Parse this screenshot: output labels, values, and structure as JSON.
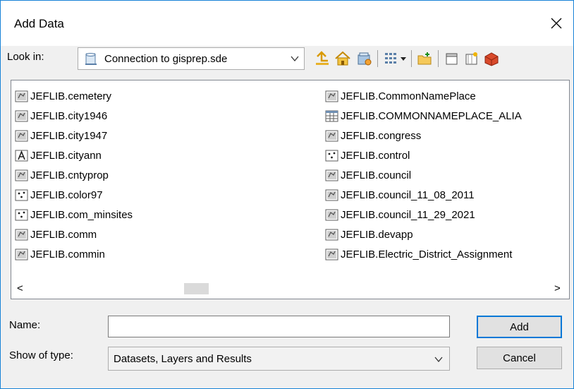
{
  "window": {
    "title": "Add Data"
  },
  "look_in": {
    "label": "Look in:",
    "value": "Connection to gisprep.sde"
  },
  "toolbar": {
    "icons": [
      "up-one-level-icon",
      "home-icon",
      "connect-folder-icon",
      "view-options-icon",
      "view-dropdown-icon",
      "new-folder-icon",
      "new-file-icon",
      "new-shapefile-icon",
      "toolbox-icon"
    ]
  },
  "items_left": [
    {
      "label": "JEFLIB.cemetery",
      "icon": "polygon-feature-class"
    },
    {
      "label": "JEFLIB.city1946",
      "icon": "polygon-feature-class"
    },
    {
      "label": "JEFLIB.city1947",
      "icon": "polygon-feature-class"
    },
    {
      "label": "JEFLIB.cityann",
      "icon": "annotation-class"
    },
    {
      "label": "JEFLIB.cntyprop",
      "icon": "polygon-feature-class"
    },
    {
      "label": "JEFLIB.color97",
      "icon": "point-feature-class"
    },
    {
      "label": "JEFLIB.com_minsites",
      "icon": "point-feature-class"
    },
    {
      "label": "JEFLIB.comm",
      "icon": "polygon-feature-class"
    },
    {
      "label": "JEFLIB.commin",
      "icon": "polygon-feature-class"
    }
  ],
  "items_right": [
    {
      "label": "JEFLIB.CommonNamePlace",
      "icon": "polygon-feature-class"
    },
    {
      "label": "JEFLIB.COMMONNAMEPLACE_ALIA",
      "icon": "table"
    },
    {
      "label": "JEFLIB.congress",
      "icon": "polygon-feature-class"
    },
    {
      "label": "JEFLIB.control",
      "icon": "point-feature-class"
    },
    {
      "label": "JEFLIB.council",
      "icon": "polygon-feature-class"
    },
    {
      "label": "JEFLIB.council_11_08_2011",
      "icon": "polygon-feature-class"
    },
    {
      "label": "JEFLIB.council_11_29_2021",
      "icon": "polygon-feature-class"
    },
    {
      "label": "JEFLIB.devapp",
      "icon": "polygon-feature-class"
    },
    {
      "label": "JEFLIB.Electric_District_Assignment",
      "icon": "polygon-feature-class"
    }
  ],
  "name": {
    "label": "Name:",
    "value": "",
    "placeholder": ""
  },
  "show_type": {
    "label": "Show of type:",
    "value": "Datasets, Layers and Results"
  },
  "buttons": {
    "add": "Add",
    "cancel": "Cancel"
  },
  "scrollbar": {
    "left_arrow": "<",
    "right_arrow": ">"
  },
  "colors": {
    "accent": "#0078d7",
    "background": "#f0f0f0"
  }
}
